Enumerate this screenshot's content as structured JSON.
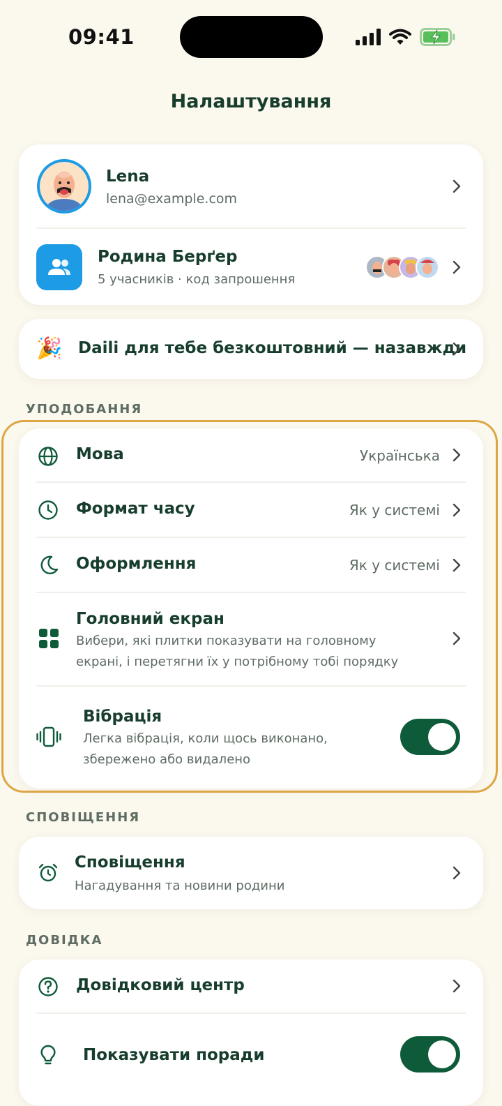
{
  "status": {
    "time": "09:41"
  },
  "title": "Налаштування",
  "profile": {
    "name": "Lena",
    "email": "lena@example.com"
  },
  "family": {
    "name": "Родина Берґер",
    "subtitle": "5 учасників · код запрошення"
  },
  "promo": {
    "emoji": "🎉",
    "text": "Daili для тебе безкоштовний — назавжди"
  },
  "sections": {
    "preferences": "УПОДОБАННЯ",
    "notifications": "СПОВІЩЕННЯ",
    "help": "ДОВІДКА"
  },
  "preferences": {
    "language": {
      "label": "Мова",
      "value": "Українська"
    },
    "time_format": {
      "label": "Формат часу",
      "value": "Як у системі"
    },
    "appearance": {
      "label": "Оформлення",
      "value": "Як у системі"
    },
    "home_screen": {
      "label": "Головний екран",
      "desc": "Вибери, які плитки показувати на головному екрані, і перетягни їх у потрібному тобі порядку"
    },
    "vibration": {
      "label": "Вібрація",
      "desc": "Легка вібрація, коли щось виконано, збережено або видалено",
      "enabled": true
    }
  },
  "notifications": {
    "label": "Сповіщення",
    "desc": "Нагадування та новини родини"
  },
  "help": {
    "help_center": {
      "label": "Довідковий центр"
    },
    "tips": {
      "label": "Показувати поради",
      "enabled": true
    }
  },
  "colors": {
    "accent": "#0E5B3A",
    "highlight": "#DDA543",
    "family_icon_bg": "#1E9BE5",
    "background": "#FBF8EE"
  }
}
